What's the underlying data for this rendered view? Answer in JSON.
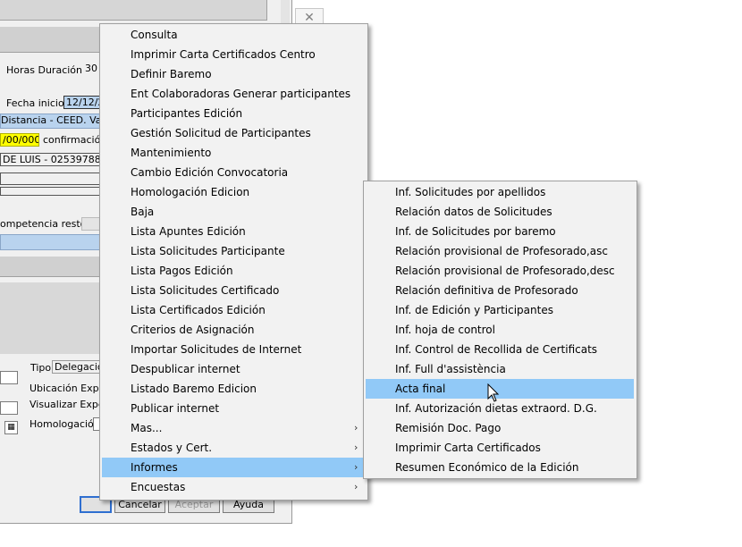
{
  "dialog": {
    "horas_label": "Horas Duración :",
    "horas_value": "30",
    "fecha_label": "Fecha inicio:",
    "fecha_value": "12/12/2",
    "centro_value": "Distancia - CEED. Valen",
    "confirm_date": "/00/0000",
    "confirm_label": "confirmación",
    "persona_value": "DE LUIS - 025397885",
    "competencia_label": "ompetencia resto",
    "tipo_label": "Tipo:",
    "tipo_value": "Delegación",
    "ubicacion_label": "Ubicación Exped",
    "visualizar_label": "Visualizar Exped",
    "homologacion_label": "Homologación:",
    "buttons": {
      "cancel": "Cancelar",
      "accept": "Aceptar",
      "help": "Ayuda"
    },
    "close_glyph": "✕"
  },
  "main_menu": {
    "items": [
      {
        "label": "Consulta"
      },
      {
        "label": "Imprimir Carta Certificados Centro"
      },
      {
        "label": "Definir Baremo"
      },
      {
        "label": "Ent Colaboradoras Generar participantes"
      },
      {
        "label": "Participantes Edición"
      },
      {
        "label": "Gestión Solicitud de Participantes"
      },
      {
        "label": "Mantenimiento"
      },
      {
        "label": "Cambio Edición Convocatoria"
      },
      {
        "label": "Homologación Edicion"
      },
      {
        "label": "Baja"
      },
      {
        "label": "Lista Apuntes Edición"
      },
      {
        "label": "Lista Solicitudes Participante"
      },
      {
        "label": "Lista Pagos Edición"
      },
      {
        "label": "Lista Solicitudes Certificado"
      },
      {
        "label": "Lista Certificados Edición"
      },
      {
        "label": "Criterios de Asignación"
      },
      {
        "label": "Importar Solicitudes de Internet"
      },
      {
        "label": "Despublicar internet"
      },
      {
        "label": "Listado Baremo Edicion"
      },
      {
        "label": "Publicar internet"
      },
      {
        "label": "Mas...",
        "submenu": true
      },
      {
        "label": "Estados y Cert.",
        "submenu": true
      },
      {
        "label": "Informes",
        "submenu": true,
        "highlighted": true
      },
      {
        "label": "Encuestas",
        "submenu": true
      }
    ]
  },
  "informes_menu": {
    "items": [
      {
        "label": "Inf. Solicitudes por apellidos"
      },
      {
        "label": "Relación datos de Solicitudes"
      },
      {
        "label": "Inf. de Solicitudes por baremo"
      },
      {
        "label": "Relación provisional de Profesorado,asc"
      },
      {
        "label": "Relación provisional de Profesorado,desc"
      },
      {
        "label": "Relación definitiva de Profesorado"
      },
      {
        "label": "Inf. de Edición y Participantes"
      },
      {
        "label": "Inf. hoja de control"
      },
      {
        "label": "Inf. Control de Recollida de Certificats"
      },
      {
        "label": "Inf. Full d'assistència"
      },
      {
        "label": "Acta final",
        "highlighted": true
      },
      {
        "label": "Inf. Autorización dietas extraord. D.G."
      },
      {
        "label": "Remisión Doc. Pago"
      },
      {
        "label": "Imprimir Carta Certificados"
      },
      {
        "label": "Resumen Económico de la Edición"
      }
    ]
  },
  "submenu_arrow": "›",
  "colors": {
    "highlight": "#91c9f7",
    "menu_bg": "#f2f2f2",
    "field_blue": "#b9d3ee",
    "yellow": "#ffff00"
  }
}
